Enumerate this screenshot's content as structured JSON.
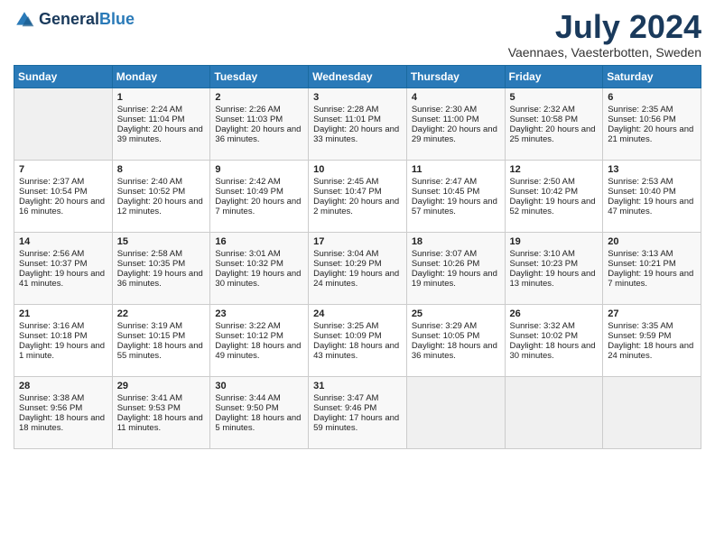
{
  "header": {
    "logo_line1": "General",
    "logo_line2": "Blue",
    "month_title": "July 2024",
    "location": "Vaennaes, Vaesterbotten, Sweden"
  },
  "days_of_week": [
    "Sunday",
    "Monday",
    "Tuesday",
    "Wednesday",
    "Thursday",
    "Friday",
    "Saturday"
  ],
  "weeks": [
    [
      {
        "day": "",
        "content": ""
      },
      {
        "day": "1",
        "content": "Sunrise: 2:24 AM\nSunset: 11:04 PM\nDaylight: 20 hours and 39 minutes."
      },
      {
        "day": "2",
        "content": "Sunrise: 2:26 AM\nSunset: 11:03 PM\nDaylight: 20 hours and 36 minutes."
      },
      {
        "day": "3",
        "content": "Sunrise: 2:28 AM\nSunset: 11:01 PM\nDaylight: 20 hours and 33 minutes."
      },
      {
        "day": "4",
        "content": "Sunrise: 2:30 AM\nSunset: 11:00 PM\nDaylight: 20 hours and 29 minutes."
      },
      {
        "day": "5",
        "content": "Sunrise: 2:32 AM\nSunset: 10:58 PM\nDaylight: 20 hours and 25 minutes."
      },
      {
        "day": "6",
        "content": "Sunrise: 2:35 AM\nSunset: 10:56 PM\nDaylight: 20 hours and 21 minutes."
      }
    ],
    [
      {
        "day": "7",
        "content": "Sunrise: 2:37 AM\nSunset: 10:54 PM\nDaylight: 20 hours and 16 minutes."
      },
      {
        "day": "8",
        "content": "Sunrise: 2:40 AM\nSunset: 10:52 PM\nDaylight: 20 hours and 12 minutes."
      },
      {
        "day": "9",
        "content": "Sunrise: 2:42 AM\nSunset: 10:49 PM\nDaylight: 20 hours and 7 minutes."
      },
      {
        "day": "10",
        "content": "Sunrise: 2:45 AM\nSunset: 10:47 PM\nDaylight: 20 hours and 2 minutes."
      },
      {
        "day": "11",
        "content": "Sunrise: 2:47 AM\nSunset: 10:45 PM\nDaylight: 19 hours and 57 minutes."
      },
      {
        "day": "12",
        "content": "Sunrise: 2:50 AM\nSunset: 10:42 PM\nDaylight: 19 hours and 52 minutes."
      },
      {
        "day": "13",
        "content": "Sunrise: 2:53 AM\nSunset: 10:40 PM\nDaylight: 19 hours and 47 minutes."
      }
    ],
    [
      {
        "day": "14",
        "content": "Sunrise: 2:56 AM\nSunset: 10:37 PM\nDaylight: 19 hours and 41 minutes."
      },
      {
        "day": "15",
        "content": "Sunrise: 2:58 AM\nSunset: 10:35 PM\nDaylight: 19 hours and 36 minutes."
      },
      {
        "day": "16",
        "content": "Sunrise: 3:01 AM\nSunset: 10:32 PM\nDaylight: 19 hours and 30 minutes."
      },
      {
        "day": "17",
        "content": "Sunrise: 3:04 AM\nSunset: 10:29 PM\nDaylight: 19 hours and 24 minutes."
      },
      {
        "day": "18",
        "content": "Sunrise: 3:07 AM\nSunset: 10:26 PM\nDaylight: 19 hours and 19 minutes."
      },
      {
        "day": "19",
        "content": "Sunrise: 3:10 AM\nSunset: 10:23 PM\nDaylight: 19 hours and 13 minutes."
      },
      {
        "day": "20",
        "content": "Sunrise: 3:13 AM\nSunset: 10:21 PM\nDaylight: 19 hours and 7 minutes."
      }
    ],
    [
      {
        "day": "21",
        "content": "Sunrise: 3:16 AM\nSunset: 10:18 PM\nDaylight: 19 hours and 1 minute."
      },
      {
        "day": "22",
        "content": "Sunrise: 3:19 AM\nSunset: 10:15 PM\nDaylight: 18 hours and 55 minutes."
      },
      {
        "day": "23",
        "content": "Sunrise: 3:22 AM\nSunset: 10:12 PM\nDaylight: 18 hours and 49 minutes."
      },
      {
        "day": "24",
        "content": "Sunrise: 3:25 AM\nSunset: 10:09 PM\nDaylight: 18 hours and 43 minutes."
      },
      {
        "day": "25",
        "content": "Sunrise: 3:29 AM\nSunset: 10:05 PM\nDaylight: 18 hours and 36 minutes."
      },
      {
        "day": "26",
        "content": "Sunrise: 3:32 AM\nSunset: 10:02 PM\nDaylight: 18 hours and 30 minutes."
      },
      {
        "day": "27",
        "content": "Sunrise: 3:35 AM\nSunset: 9:59 PM\nDaylight: 18 hours and 24 minutes."
      }
    ],
    [
      {
        "day": "28",
        "content": "Sunrise: 3:38 AM\nSunset: 9:56 PM\nDaylight: 18 hours and 18 minutes."
      },
      {
        "day": "29",
        "content": "Sunrise: 3:41 AM\nSunset: 9:53 PM\nDaylight: 18 hours and 11 minutes."
      },
      {
        "day": "30",
        "content": "Sunrise: 3:44 AM\nSunset: 9:50 PM\nDaylight: 18 hours and 5 minutes."
      },
      {
        "day": "31",
        "content": "Sunrise: 3:47 AM\nSunset: 9:46 PM\nDaylight: 17 hours and 59 minutes."
      },
      {
        "day": "",
        "content": ""
      },
      {
        "day": "",
        "content": ""
      },
      {
        "day": "",
        "content": ""
      }
    ]
  ]
}
